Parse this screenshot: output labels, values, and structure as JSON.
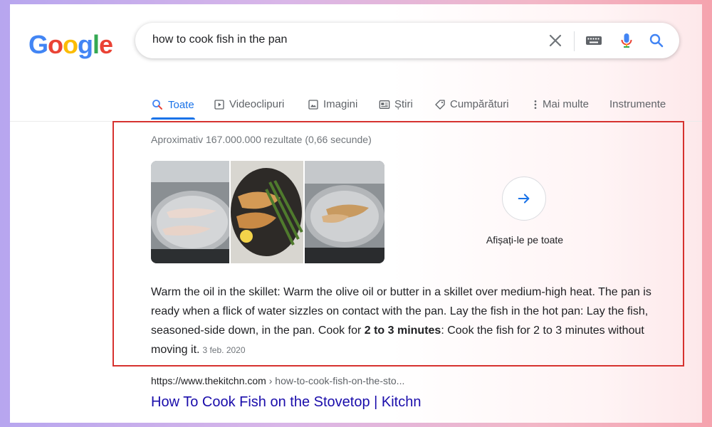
{
  "logo": {
    "letters": [
      "G",
      "o",
      "o",
      "g",
      "l",
      "e"
    ],
    "colors": [
      "#4285f4",
      "#ea4335",
      "#fbbc05",
      "#4285f4",
      "#34a853",
      "#ea4335"
    ]
  },
  "search": {
    "query": "how to cook fish in the pan",
    "icons": [
      "close-icon",
      "keyboard-icon",
      "microphone-icon",
      "search-icon"
    ]
  },
  "tabs": [
    {
      "label": "Toate",
      "icon": "search-icon",
      "active": true
    },
    {
      "label": "Videoclipuri",
      "icon": "play-icon"
    },
    {
      "label": "Imagini",
      "icon": "image-icon"
    },
    {
      "label": "Știri",
      "icon": "news-icon"
    },
    {
      "label": "Cumpărături",
      "icon": "tag-icon"
    },
    {
      "label": "Mai multe",
      "icon": "more-vert-icon"
    },
    {
      "label": "Instrumente"
    }
  ],
  "results": {
    "stats": "Aproximativ 167.000.000 rezultate (0,66 secunde)",
    "show_all_label": "Afișați-le pe toate",
    "snippet": {
      "part1": "Warm the oil in the skillet: Warm the olive oil or butter in a skillet over medium-high heat. The pan is ready when a flick of water sizzles on contact with the pan. Lay the fish in the hot pan: Lay the fish, seasoned-side down, in the pan. Cook for ",
      "bold": "2 to 3 minutes",
      "part2": ": Cook the fish for 2 to 3 minutes without moving it.",
      "date": "3 feb. 2020"
    },
    "cite": {
      "domain": "https://www.thekitchn.com",
      "path": " › how-to-cook-fish-on-the-sto..."
    },
    "title": "How To Cook Fish on the Stovetop | Kitchn"
  },
  "colors": {
    "accent": "#1a73e8",
    "highlight_border": "#d6322f",
    "link": "#1a0dab"
  }
}
